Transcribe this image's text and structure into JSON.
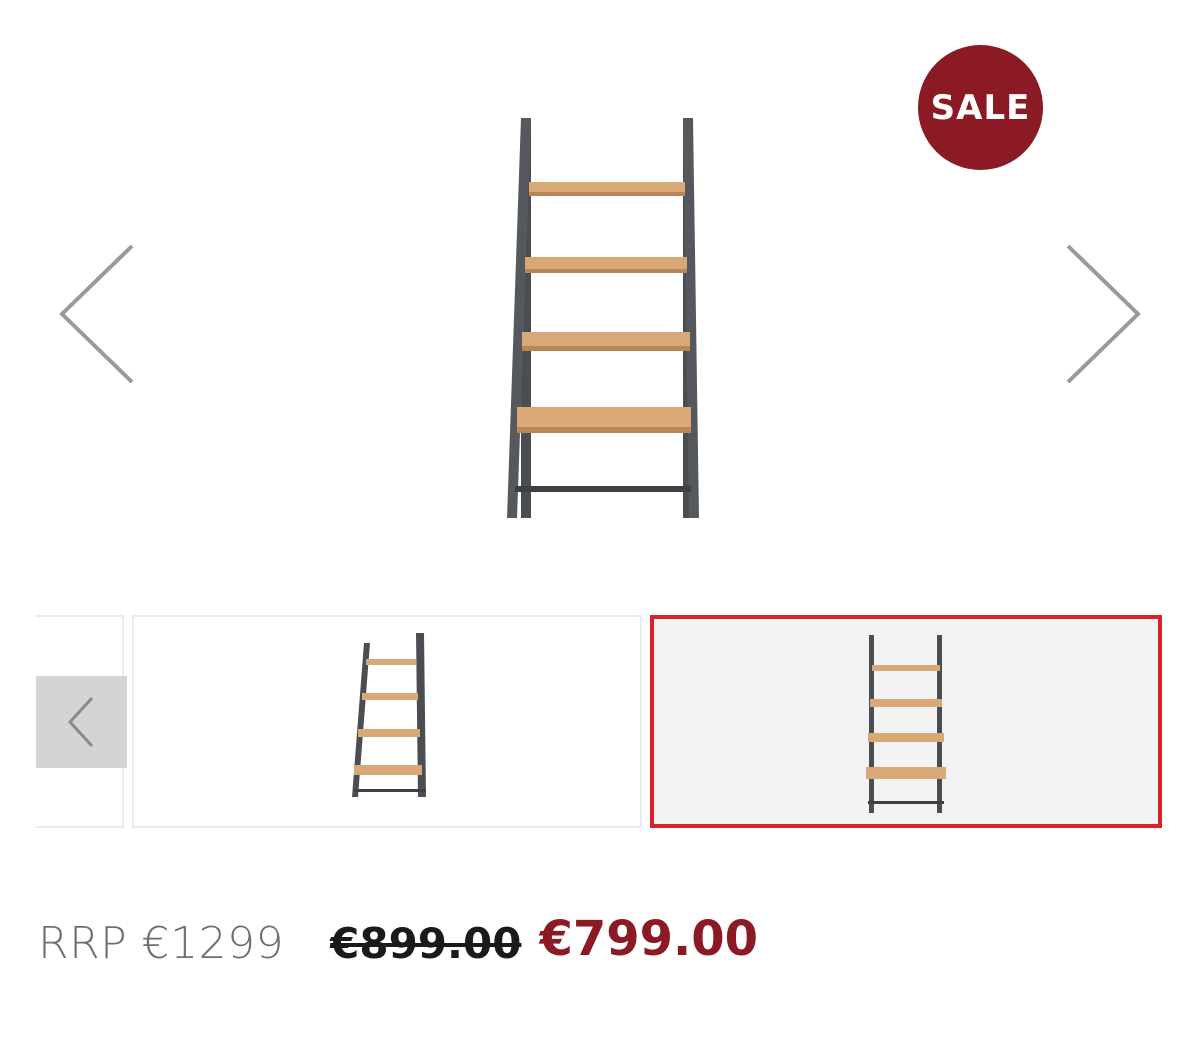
{
  "gallery": {
    "badge_label": "SALE",
    "prev_icon": "chevron-left-icon",
    "next_icon": "chevron-right-icon",
    "main_image_icon": "ladder-shelf-image",
    "thumbnails": [
      {
        "name": "ladder-shelf-angled-thumb",
        "selected": false
      },
      {
        "name": "ladder-shelf-front-thumb",
        "selected": true
      }
    ]
  },
  "pricing": {
    "rrp": "RRP €1299",
    "old_price": "€899.00",
    "new_price": "€799.00"
  },
  "colors": {
    "sale_red": "#8c1a24",
    "selected_border": "#d6232c",
    "wood": "#d9a877",
    "metal": "#4a4d52"
  }
}
